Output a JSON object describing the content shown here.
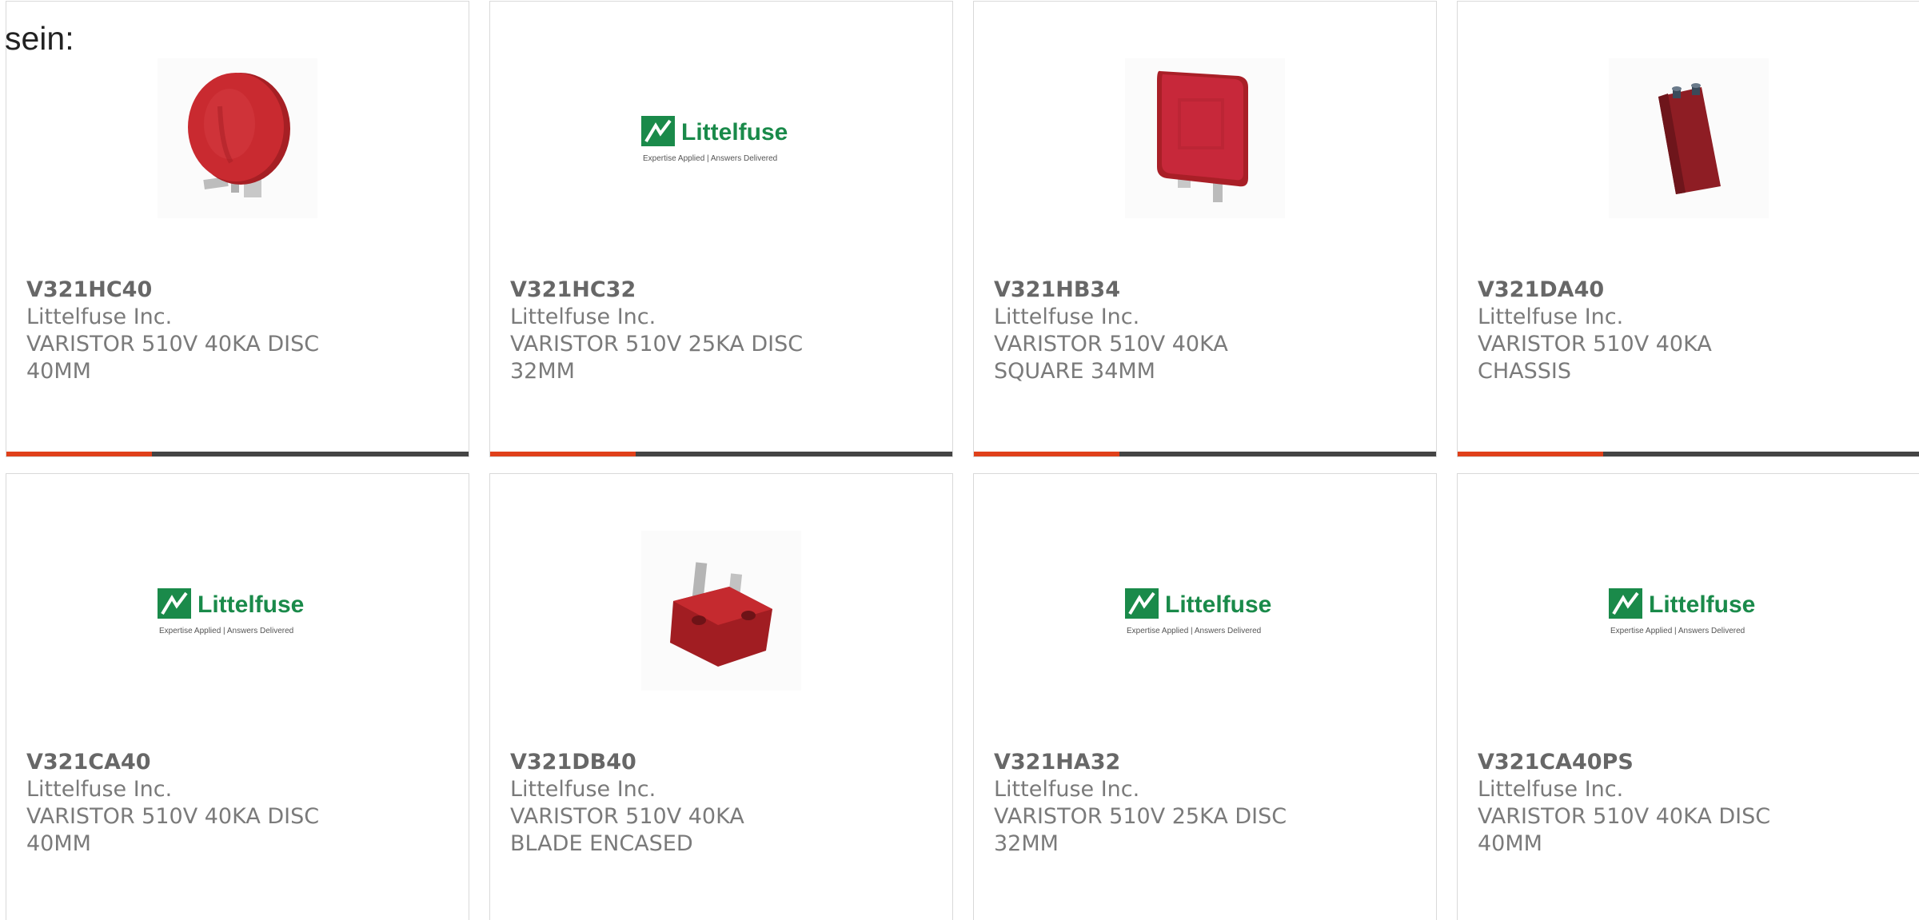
{
  "intro_text": "sein:",
  "colors": {
    "accent": "#e0401a",
    "bar_dark": "#444444",
    "brand_green": "#1a8a4a",
    "varistor_red": "#c0282c"
  },
  "logo": {
    "brand": "Littelfuse",
    "tagline": "Expertise Applied | Answers Delivered"
  },
  "products": [
    {
      "part_number": "V321HC40",
      "manufacturer": "Littelfuse Inc.",
      "description": "VARISTOR 510V 40KA DISC 40MM",
      "image": "disc-varistor-photo"
    },
    {
      "part_number": "V321HC32",
      "manufacturer": "Littelfuse Inc.",
      "description": "VARISTOR 510V 25KA DISC 32MM",
      "image": "littelfuse-logo"
    },
    {
      "part_number": "V321HB34",
      "manufacturer": "Littelfuse Inc.",
      "description": "VARISTOR 510V 40KA SQUARE 34MM",
      "image": "square-varistor-photo"
    },
    {
      "part_number": "V321DA40",
      "manufacturer": "Littelfuse Inc.",
      "description": "VARISTOR 510V 40KA CHASSIS",
      "image": "chassis-varistor-photo"
    },
    {
      "part_number": "V321CA40",
      "manufacturer": "Littelfuse Inc.",
      "description": "VARISTOR 510V 40KA DISC 40MM",
      "image": "littelfuse-logo"
    },
    {
      "part_number": "V321DB40",
      "manufacturer": "Littelfuse Inc.",
      "description": "VARISTOR 510V 40KA BLADE ENCASED",
      "image": "blade-varistor-photo"
    },
    {
      "part_number": "V321HA32",
      "manufacturer": "Littelfuse Inc.",
      "description": "VARISTOR 510V 25KA DISC 32MM",
      "image": "littelfuse-logo"
    },
    {
      "part_number": "V321CA40PS",
      "manufacturer": "Littelfuse Inc.",
      "description": "VARISTOR 510V 40KA DISC 40MM",
      "image": "littelfuse-logo"
    }
  ]
}
